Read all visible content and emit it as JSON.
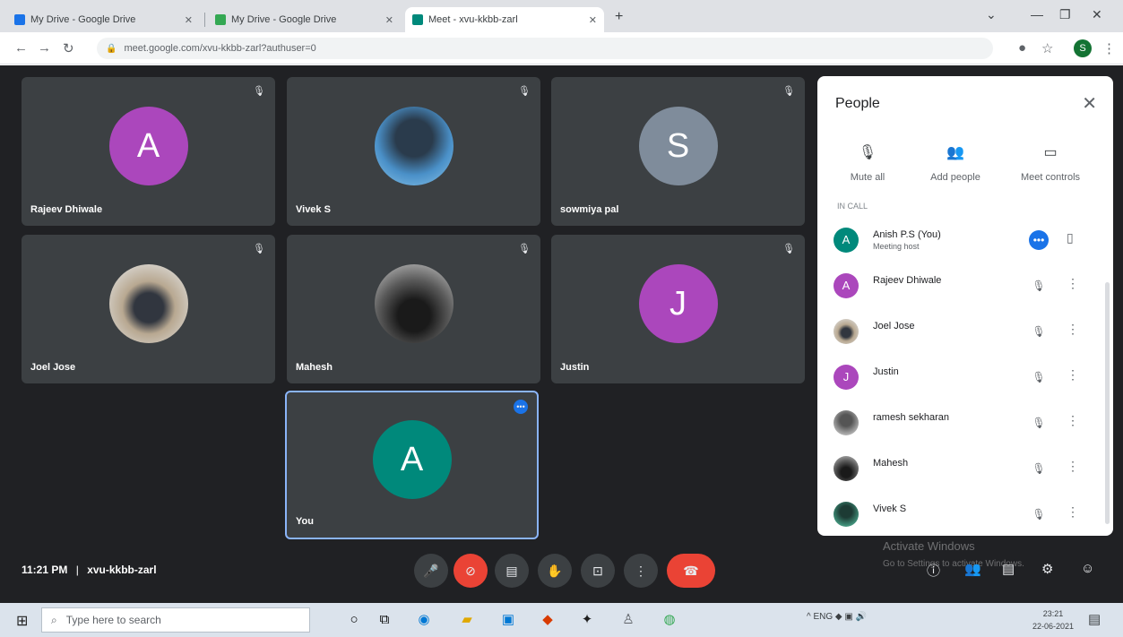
{
  "browser": {
    "tabs": [
      {
        "title": "My Drive - Google Drive",
        "favicon_color": "#1a73e8"
      },
      {
        "title": "My Drive - Google Drive",
        "favicon_color": "#34a853"
      },
      {
        "title": "Meet - xvu-kkbb-zarl",
        "favicon_color": "#00897b"
      }
    ],
    "new_tab": "+",
    "url": "meet.google.com/xvu-kkbb-zarl?authuser=0",
    "profile_initial": "S",
    "window_controls": [
      "—",
      "❐",
      "✕"
    ]
  },
  "tiles": [
    {
      "name": "Rajeev Dhiwale",
      "type": "letter",
      "letter": "A",
      "color": "#ab47bc",
      "muted": true
    },
    {
      "name": "Vivek S",
      "type": "photo",
      "letter": "",
      "color": "",
      "muted": true
    },
    {
      "name": "sowmiya pal",
      "type": "letter",
      "letter": "S",
      "color": "#7f8c9b",
      "muted": true
    },
    {
      "name": "Joel Jose",
      "type": "photo",
      "letter": "",
      "color": "",
      "muted": true
    },
    {
      "name": "Mahesh",
      "type": "photo",
      "letter": "",
      "color": "",
      "muted": true
    },
    {
      "name": "Justin",
      "type": "letter",
      "letter": "J",
      "color": "#ab47bc",
      "muted": true
    },
    {
      "name": "You",
      "type": "letter",
      "letter": "A",
      "color": "#00897b",
      "muted": false
    }
  ],
  "people_panel": {
    "title": "People",
    "close": "✕",
    "actions": [
      {
        "icon": "🎙",
        "label": "Mute all"
      },
      {
        "icon": "👥",
        "label": "Add people"
      },
      {
        "icon": "▭",
        "label": "Meet controls"
      }
    ],
    "caption": "IN CALL",
    "participants": [
      {
        "name": "Anish P.S (You)",
        "sub": "Meeting host",
        "letter": "A",
        "color": "#00897b",
        "mic_on": true,
        "more": "▯"
      },
      {
        "name": "Rajeev Dhiwale",
        "sub": "",
        "letter": "A",
        "color": "#ab47bc",
        "mic_on": false,
        "more": "⋮"
      },
      {
        "name": "Joel Jose",
        "sub": "",
        "letter": "",
        "color": "#6d6d6d",
        "mic_on": false,
        "more": "⋮"
      },
      {
        "name": "Justin",
        "sub": "",
        "letter": "J",
        "color": "#ab47bc",
        "mic_on": false,
        "more": "⋮"
      },
      {
        "name": "ramesh sekharan",
        "sub": "",
        "letter": "",
        "color": "#8a8a8a",
        "mic_on": false,
        "more": "⋮"
      },
      {
        "name": "Mahesh",
        "sub": "",
        "letter": "",
        "color": "#2b2b2b",
        "mic_on": false,
        "more": "⋮"
      },
      {
        "name": "Vivek S",
        "sub": "",
        "letter": "",
        "color": "#2e6b5a",
        "mic_on": false,
        "more": "⋮"
      }
    ]
  },
  "meeting": {
    "time": "11:21 PM",
    "separator": "|",
    "code": "xvu-kkbb-zarl"
  },
  "controls": {
    "mic": "🎤",
    "camera": "⊘",
    "captions": "▤",
    "hand": "✋",
    "present": "⊡",
    "more": "⋮",
    "end": "☎"
  },
  "right_controls": [
    "ⓘ",
    "👥",
    "▤",
    "⚙",
    "☺"
  ],
  "watermark": {
    "line1": "Activate Windows",
    "line2": "Go to Settings to activate Windows."
  },
  "taskbar": {
    "search_placeholder": "Type here to search",
    "tray": "^  ENG  ◆  ▣  🔊",
    "time": "23:21",
    "date": "22-06-2021"
  }
}
